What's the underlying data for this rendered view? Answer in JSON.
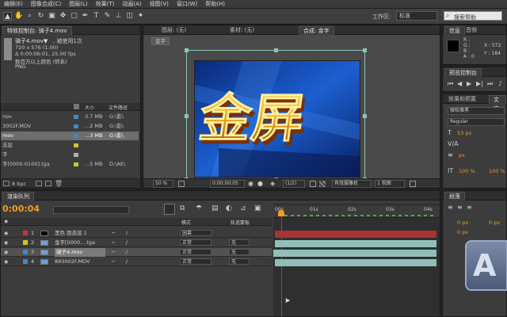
{
  "menu": [
    "编辑(E)",
    "图像合成(C)",
    "图层(L)",
    "效果(T)",
    "动画(A)",
    "视图(V)",
    "窗口(W)",
    "帮助(H)"
  ],
  "toolbar": {
    "workspace_label": "工作区:",
    "workspace_value": "标准",
    "search_placeholder": "搜索帮助"
  },
  "project_panel": {
    "tab": "特效控制台: 骑子4.mov",
    "file_name": "骑子4.mov▼",
    "used": ", 被使用1次",
    "info": [
      "720 x 576 (1.00)",
      "Δ 0:00:06:01, 25.00 fps",
      "数百万以上颜色 (转系)",
      "PNG"
    ],
    "col_size": "大小",
    "col_path": "文件路径",
    "rows": [
      {
        "name": "nov",
        "size": "3.7 MB",
        "path": "G:\\影\\"
      },
      {
        "name": "3002F.MOV",
        "size": "...2 MB",
        "path": "G:\\影\\"
      },
      {
        "name": "mov",
        "size": "...3 MB",
        "path": "G:\\影\\"
      },
      {
        "name": "志层",
        "size": "",
        "path": ""
      },
      {
        "name": "字",
        "size": "",
        "path": ""
      },
      {
        "name": "字[0000-0100].tga",
        "size": "...5 MB",
        "path": "D:\\AE\\"
      }
    ],
    "bpc": "8 bpc"
  },
  "comp_panel": {
    "tabs": [
      "图层: (无)",
      "素材: (无)",
      "合成: 金字"
    ],
    "sub_tab": "金字",
    "zoom": "50 %",
    "timecode": "0:00:00:05",
    "resolution": "(1/2)",
    "camera": "有效摄像机",
    "view": "1 视图",
    "graphic_text": "金屏"
  },
  "info_panel": {
    "tabs": [
      "信息",
      "音频"
    ],
    "channels": [
      "R :",
      "G :",
      "B :",
      "A : 0"
    ],
    "coords": [
      "X : 572",
      "Y : 184"
    ]
  },
  "preview_panel": {
    "tab": "预览控制台"
  },
  "effects_panel": {
    "tabs": [
      "效果和预置",
      "文字"
    ],
    "font": "微软雅黑",
    "style": "Regular",
    "size1": "53 px",
    "size2": "px",
    "scale1": "100 %",
    "scale2": "100 %"
  },
  "paragraph_panel": {
    "tab": "段落",
    "fields": [
      "0 px",
      "0 px",
      "0 px"
    ]
  },
  "timeline": {
    "tab": "渲染队列",
    "time": "0:00:04",
    "col_mode": "模式",
    "col_track": "轨道蒙板",
    "col_parent": "父级",
    "ruler": [
      "00s",
      "01s",
      "02s",
      "03s",
      "04s"
    ],
    "layers": [
      {
        "num": "1",
        "name": "黑色 固态层 1",
        "mode": "园幕",
        "track": "",
        "parent": "",
        "color": "#c8323c"
      },
      {
        "num": "2",
        "name": "金字[0000....tga",
        "mode": "正常",
        "track": "无",
        "parent": "无",
        "color": "#c8c832"
      },
      {
        "num": "3",
        "name": "骑子4.mov",
        "mode": "正常",
        "track": "无",
        "parent": "无",
        "color": "#3c8ac8"
      },
      {
        "num": "4",
        "name": "893002F.MOV",
        "mode": "正常",
        "track": "无",
        "parent": "无",
        "color": "#3c8ac8"
      }
    ]
  },
  "colors": {
    "accent": "#f0a020",
    "bar_red": "#a83434",
    "bar_teal": "#8fbfb8",
    "playhead": "#d03030"
  }
}
